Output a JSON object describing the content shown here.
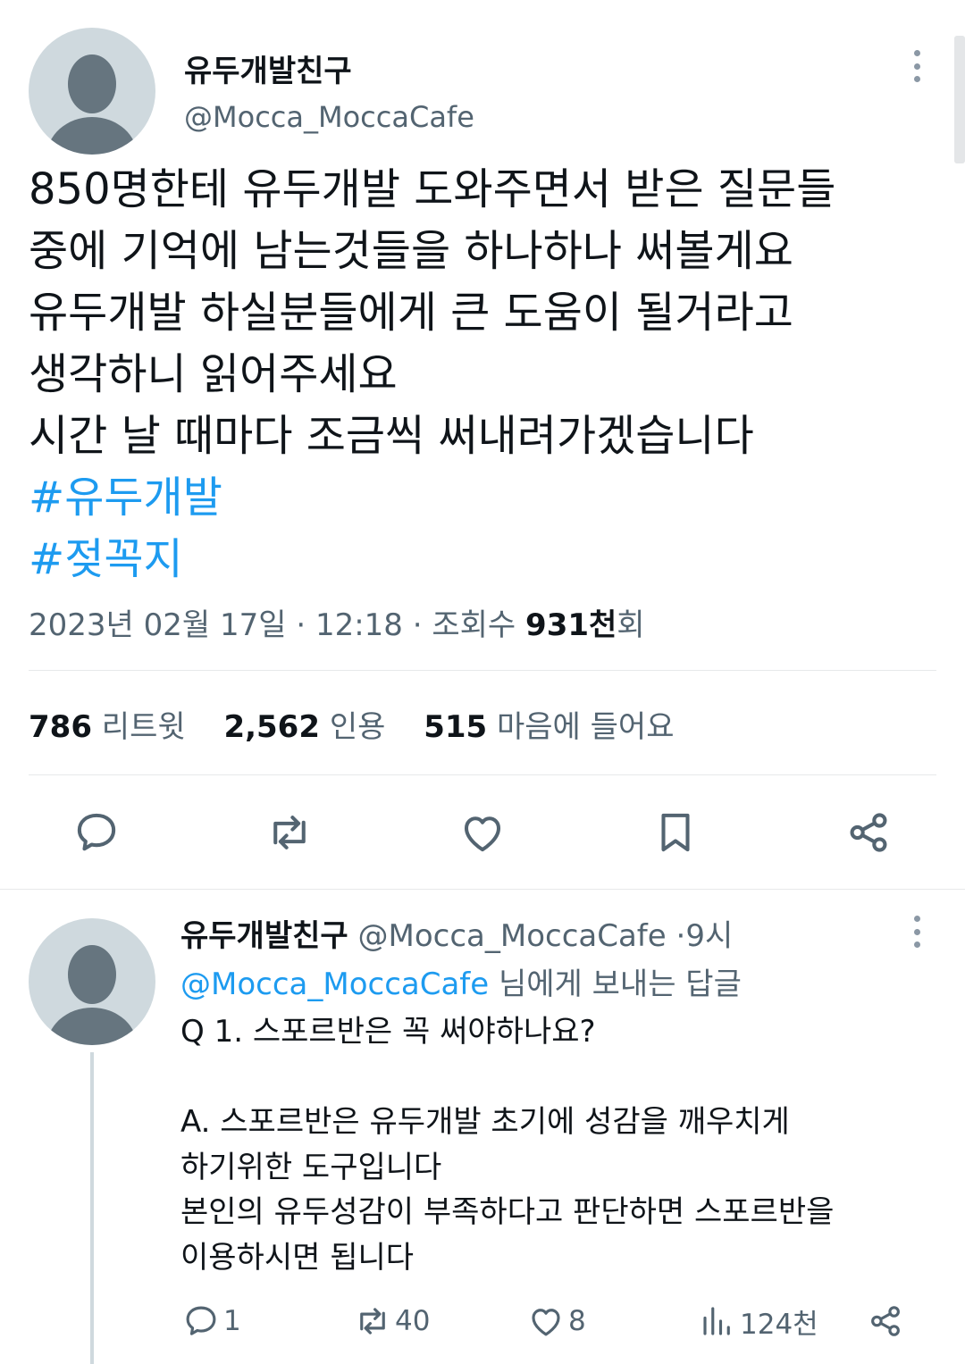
{
  "tweet": {
    "author_name": "유두개발친구",
    "author_handle": "@Mocca_MoccaCafe",
    "text_lines": [
      "850명한테 유두개발 도와주면서 받은 질문들",
      "중에 기억에 남는것들을 하나하나 써볼게요",
      "유두개발 하실분들에게 큰 도움이 될거라고",
      "생각하니 읽어주세요",
      "시간 날 때마다 조금씩 써내려가겠습니다"
    ],
    "hashtags": [
      "#유두개발",
      "#젖꼭지"
    ],
    "date": "2023년 02월 17일",
    "time": "12:18",
    "views_label": "조회수",
    "views_count": "931천",
    "views_suffix": "회",
    "separator": "·",
    "stats": {
      "retweets_count": "786",
      "retweets_label": "리트윗",
      "quotes_count": "2,562",
      "quotes_label": "인용",
      "likes_count": "515",
      "likes_label": "마음에 들어요"
    },
    "actions": [
      "reply-icon",
      "retweet-icon",
      "like-icon",
      "bookmark-icon",
      "share-icon"
    ]
  },
  "reply": {
    "author_name": "유두개발친구",
    "author_handle": "@Mocca_MoccaCafe",
    "time_ago": "9시",
    "separator": "·",
    "replying_to_handle": "@Mocca_MoccaCafe",
    "replying_to_suffix": "님에게 보내는 답글",
    "text_lines": [
      "Q 1. 스포르반은 꼭 써야하나요?",
      "",
      "A. 스포르반은 유두개발 초기에 성감을 깨우치게",
      "하기위한 도구입니다",
      "본인의 유두성감이 부족하다고 판단하면 스포르반을",
      "이용하시면 됩니다"
    ],
    "reply_count": "1",
    "retweet_count": "40",
    "like_count": "8",
    "views_count": "124천"
  },
  "colors": {
    "accent": "#1d9bf0",
    "text": "#0f1419",
    "muted": "#536471",
    "avatar_bg": "#cfd9de"
  }
}
